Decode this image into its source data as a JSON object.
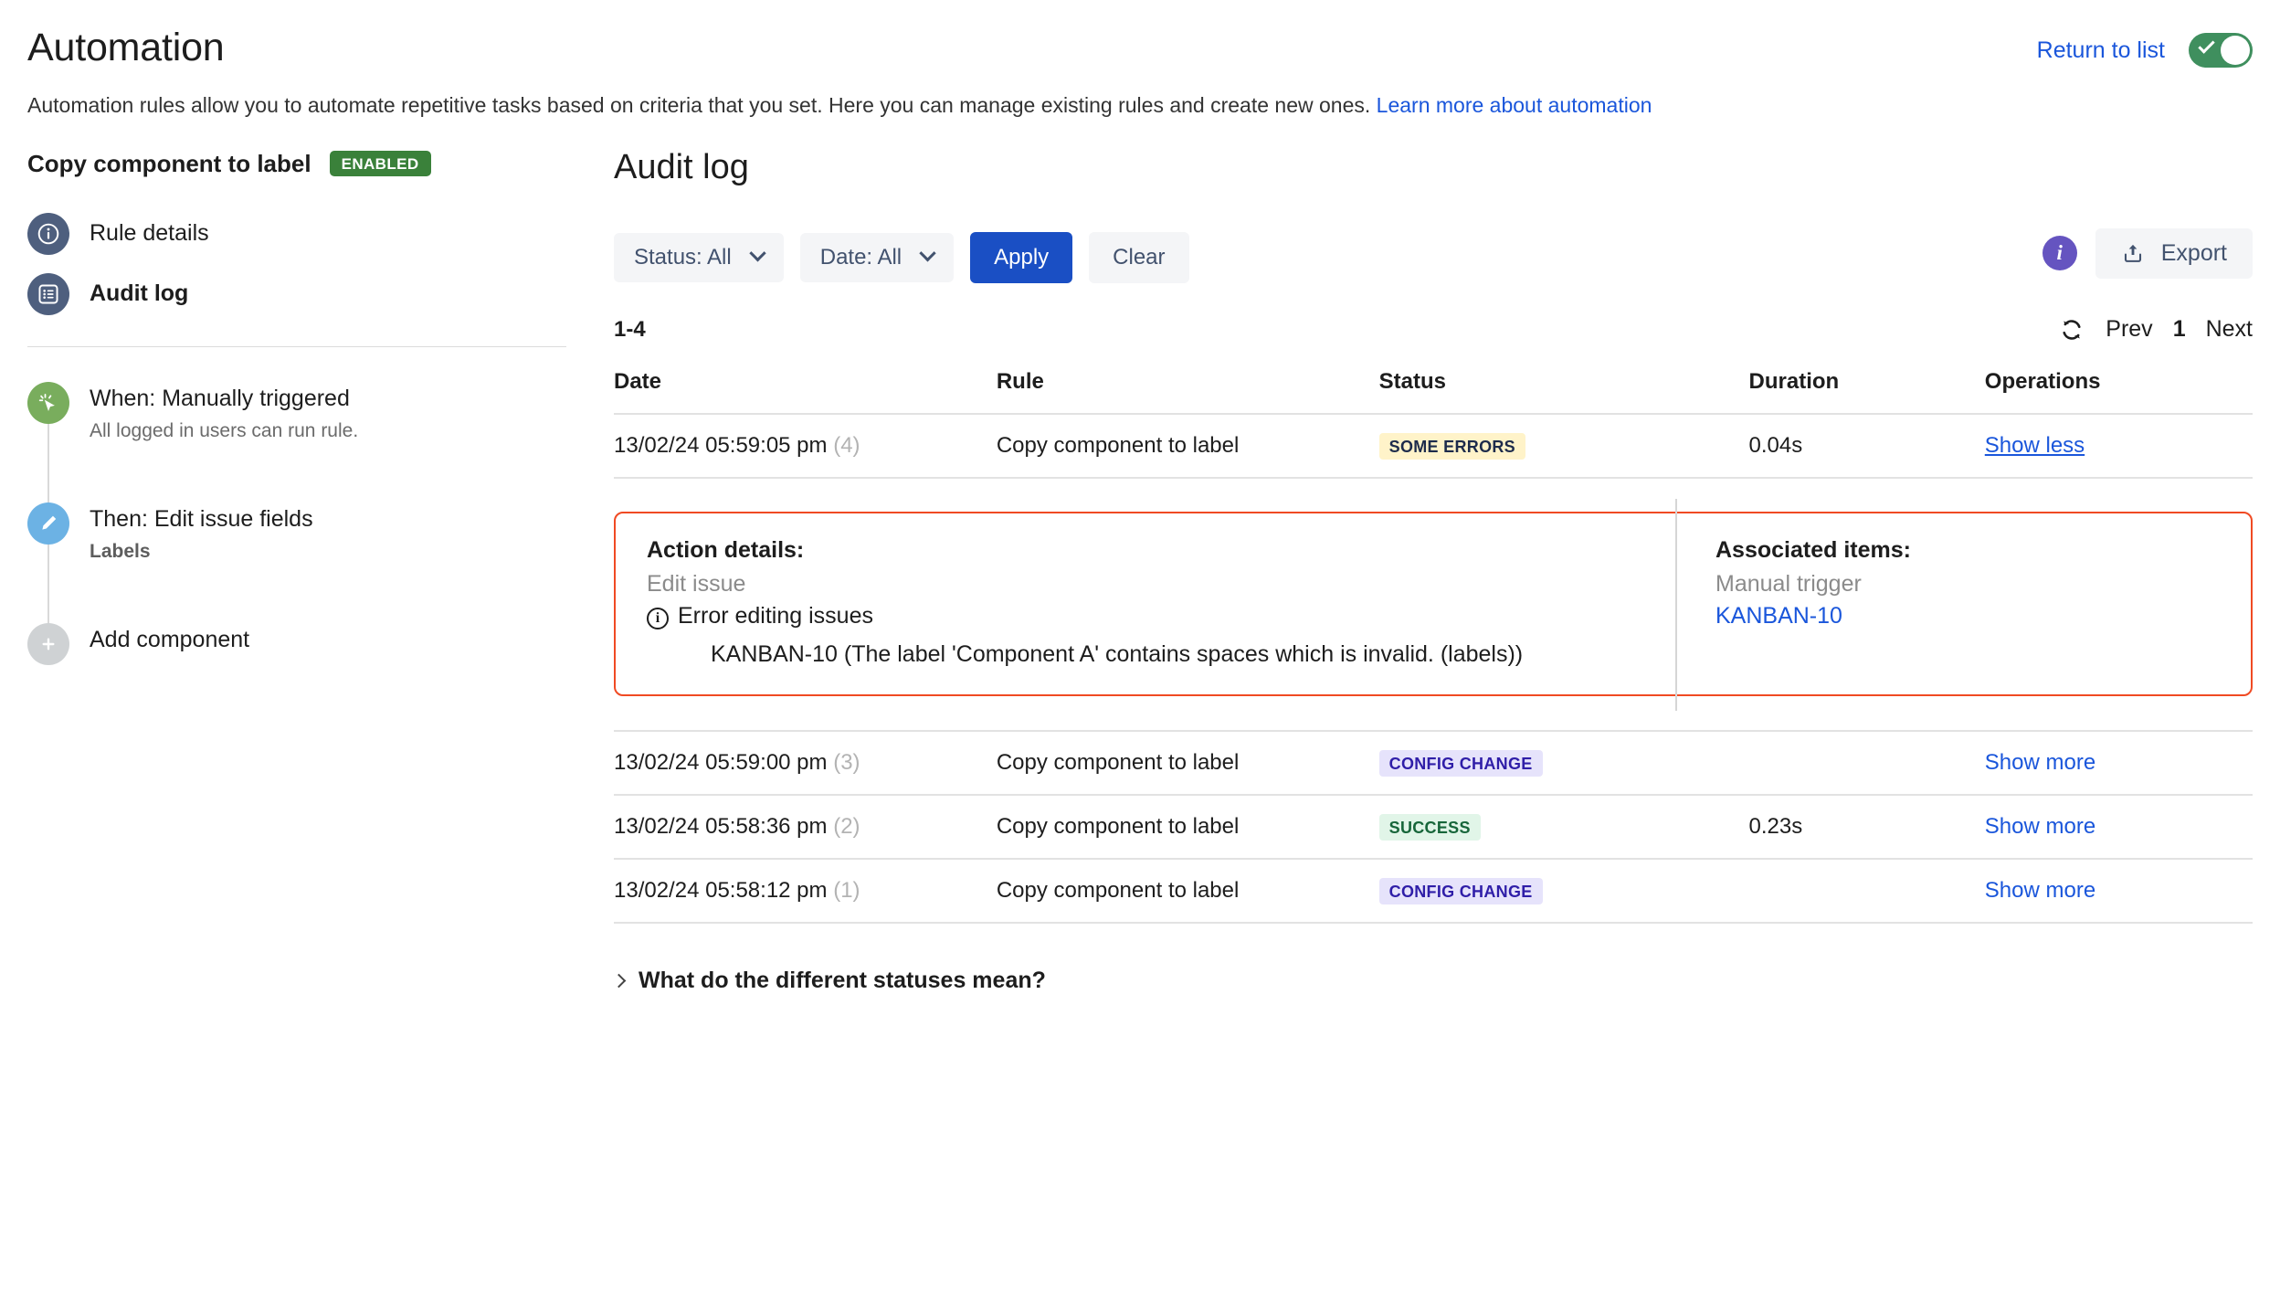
{
  "header": {
    "title": "Automation",
    "return_link": "Return to list",
    "toggle_state": "on",
    "description": "Automation rules allow you to automate repetitive tasks based on criteria that you set. Here you can manage existing rules and create new ones.",
    "learn_more": "Learn more about automation"
  },
  "sidebar": {
    "rule_name": "Copy component to label",
    "rule_status_badge": "ENABLED",
    "nav": [
      {
        "label": "Rule details",
        "icon": "info-circle-icon",
        "active": false
      },
      {
        "label": "Audit log",
        "icon": "list-icon",
        "active": true
      }
    ],
    "steps": [
      {
        "title": "When: Manually triggered",
        "subtitle": "All logged in users can run rule.",
        "icon": "cursor-click-icon",
        "color": "green",
        "bold_sub": false
      },
      {
        "title": "Then: Edit issue fields",
        "subtitle": "Labels",
        "icon": "pencil-icon",
        "color": "blue",
        "bold_sub": true
      },
      {
        "title": "Add component",
        "subtitle": "",
        "icon": "plus-icon",
        "color": "grey",
        "bold_sub": false
      }
    ]
  },
  "main": {
    "title": "Audit log",
    "filters": {
      "status": "Status: All",
      "date": "Date: All",
      "apply": "Apply",
      "clear": "Clear"
    },
    "export_label": "Export",
    "info_glyph": "i",
    "count": "1-4",
    "pager": {
      "prev": "Prev",
      "current": "1",
      "next": "Next"
    },
    "table": {
      "columns": [
        "Date",
        "Rule",
        "Status",
        "Duration",
        "Operations"
      ],
      "rows": [
        {
          "date": "13/02/24 05:59:05 pm",
          "seq": "(4)",
          "rule": "Copy component to label",
          "status": "SOME ERRORS",
          "status_kind": "errors",
          "duration": "0.04s",
          "operation": "Show less",
          "expanded": true
        },
        {
          "date": "13/02/24 05:59:00 pm",
          "seq": "(3)",
          "rule": "Copy component to label",
          "status": "CONFIG CHANGE",
          "status_kind": "config",
          "duration": "",
          "operation": "Show more",
          "expanded": false
        },
        {
          "date": "13/02/24 05:58:36 pm",
          "seq": "(2)",
          "rule": "Copy component to label",
          "status": "SUCCESS",
          "status_kind": "success",
          "duration": "0.23s",
          "operation": "Show more",
          "expanded": false
        },
        {
          "date": "13/02/24 05:58:12 pm",
          "seq": "(1)",
          "rule": "Copy component to label",
          "status": "CONFIG CHANGE",
          "status_kind": "config",
          "duration": "",
          "operation": "Show more",
          "expanded": false
        }
      ]
    },
    "detail": {
      "action_heading": "Action details:",
      "action_name": "Edit issue",
      "error_title": "Error editing issues",
      "error_body": "KANBAN-10 (The label 'Component A' contains spaces which is invalid. (labels))",
      "associated_heading": "Associated items:",
      "associated_trigger": "Manual trigger",
      "associated_issue": "KANBAN-10"
    },
    "accordion_label": "What do the different statuses mean?"
  },
  "colors": {
    "link": "#1a56db",
    "primary_button": "#1a4fc4",
    "enabled_green": "#3a813a",
    "toggle_green": "#3f8f5e",
    "detail_border_red": "#f04a23",
    "badge_errors_bg": "#fff3c9",
    "badge_config_bg": "#e6e3fb",
    "badge_success_bg": "#e1f5e8",
    "info_purple": "#6554c0"
  }
}
